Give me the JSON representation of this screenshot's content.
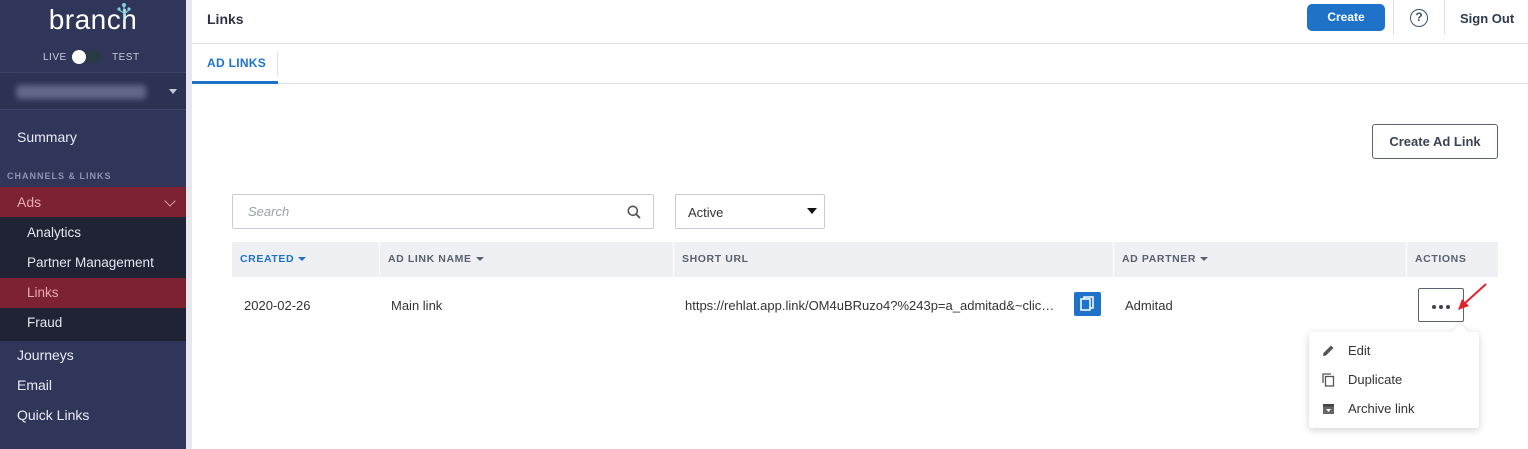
{
  "sidebar": {
    "logo": "branch",
    "env": {
      "live": "LIVE",
      "test": "TEST"
    },
    "summary": "Summary",
    "section_label": "CHANNELS & LINKS",
    "ads": "Ads",
    "sub_items": [
      "Analytics",
      "Partner Management",
      "Links",
      "Fraud"
    ],
    "items": [
      "Journeys",
      "Email",
      "Quick Links"
    ]
  },
  "header": {
    "title": "Links",
    "create_label": "Create",
    "sign_out_label": "Sign Out"
  },
  "tabs": {
    "ad_links": "AD LINKS"
  },
  "toolbar": {
    "create_ad_link_label": "Create Ad Link",
    "search_placeholder": "Search",
    "status_value": "Active"
  },
  "table": {
    "headers": [
      "CREATED",
      "AD LINK NAME",
      "SHORT URL",
      "AD PARTNER",
      "ACTIONS"
    ],
    "rows": [
      {
        "created": "2020-02-26",
        "name": "Main link",
        "short_url": "https://rehlat.app.link/OM4uBRuzo4?%243p=a_admitad&~clic…",
        "partner": "Admitad"
      }
    ]
  },
  "actions_menu": {
    "items": [
      "Edit",
      "Duplicate",
      "Archive link"
    ]
  },
  "colors": {
    "accent": "#1e73c9",
    "sidebar": "#30365a",
    "sidebar_active": "#7c2233",
    "annotation_arrow": "#e0242a"
  },
  "icons": [
    "tree-logo-icon",
    "help-icon",
    "search-icon",
    "copy-icon",
    "more-dots-icon",
    "pencil-icon",
    "duplicate-icon",
    "archive-icon",
    "chevron-down-icon"
  ]
}
